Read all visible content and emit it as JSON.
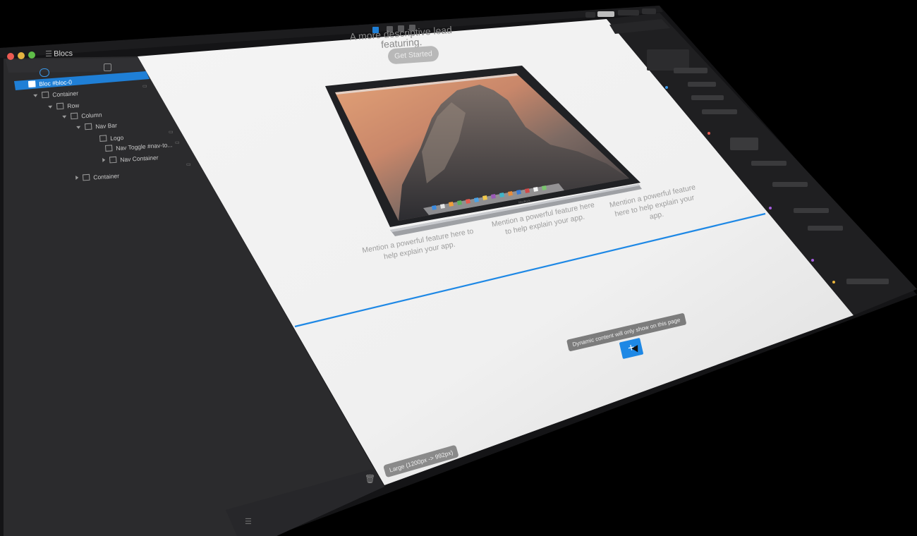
{
  "app": {
    "title": "Blocs"
  },
  "layers": {
    "items": [
      {
        "label": "Bloc #bloc-0",
        "selected": true
      },
      {
        "label": "Container"
      },
      {
        "label": "Row"
      },
      {
        "label": "Column"
      },
      {
        "label": "Nav Bar"
      },
      {
        "label": "Logo"
      },
      {
        "label": "Nav Toggle #nav-to..."
      },
      {
        "label": "Nav Container"
      },
      {
        "label": "Container"
      }
    ]
  },
  "canvas": {
    "heading": "A more descriptive lead featuring.",
    "cta_label": "Get Started",
    "features": [
      "Mention a powerful feature here to help explain your app.",
      "Mention a powerful feature here to help explain your app.",
      "Mention a powerful feature here to help explain your app."
    ],
    "dynamic_tooltip": "Dynamic content will only show on this page",
    "add_label": "+",
    "breakpoint_badge": "Large (1200px -> 992px)",
    "laptop_brand": "MacBook"
  },
  "colors": {
    "accent": "#1e88e5",
    "sidebar_bg": "#2b2b2d",
    "canvas_bg": "#f2f2f2",
    "inspector_bg": "#1f1f21",
    "window_bg": "#111111"
  },
  "icons": {
    "layers_tab": "speech-bubble-icon",
    "blocks_tab": "cube-icon",
    "trash": "trash-icon",
    "menu": "hamburger-icon"
  }
}
